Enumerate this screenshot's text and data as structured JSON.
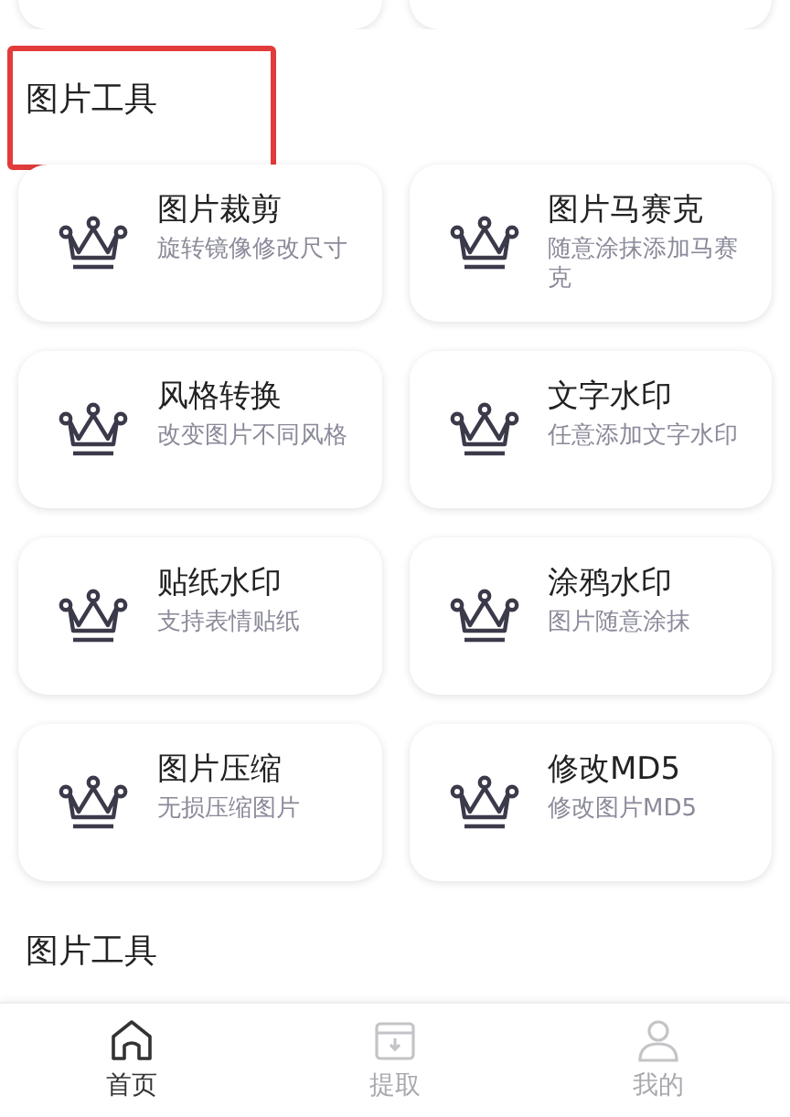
{
  "sections": [
    {
      "title": "图片工具",
      "highlighted": true,
      "tools": [
        {
          "name": "图片裁剪",
          "desc": "旋转镜像修改尺寸"
        },
        {
          "name": "图片马赛克",
          "desc": "随意涂抹添加马赛克"
        },
        {
          "name": "风格转换",
          "desc": "改变图片不同风格"
        },
        {
          "name": "文字水印",
          "desc": "任意添加文字水印"
        },
        {
          "name": "贴纸水印",
          "desc": "支持表情贴纸"
        },
        {
          "name": "涂鸦水印",
          "desc": "图片随意涂抹"
        },
        {
          "name": "图片压缩",
          "desc": "无损压缩图片"
        },
        {
          "name": "修改MD5",
          "desc": "修改图片MD5"
        }
      ]
    },
    {
      "title": "图片工具",
      "highlighted": false
    }
  ],
  "tab_bar": [
    {
      "label": "首页",
      "selected": true
    },
    {
      "label": "提取",
      "selected": false
    },
    {
      "label": "我的",
      "selected": false
    }
  ]
}
